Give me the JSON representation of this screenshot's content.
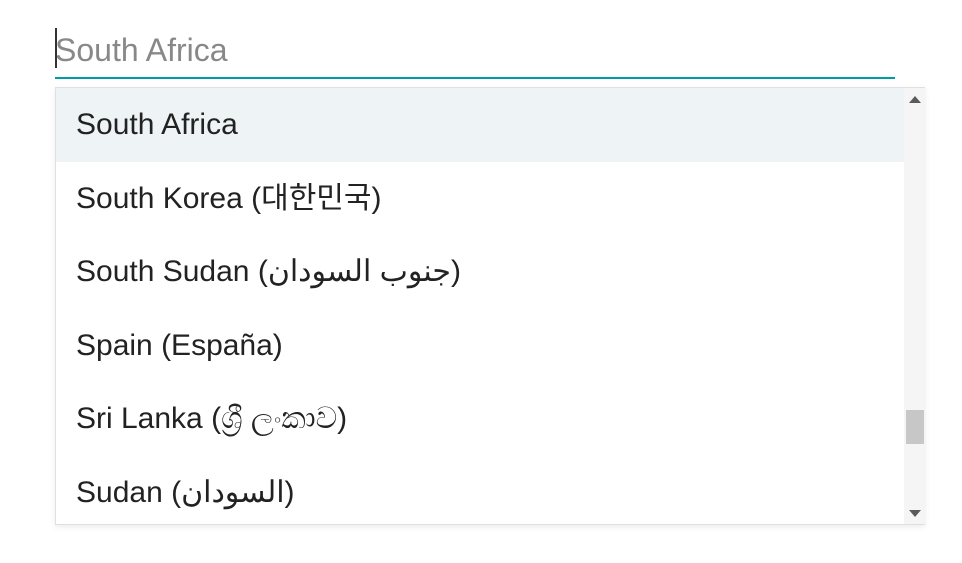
{
  "search": {
    "placeholder": "South Africa",
    "value": ""
  },
  "dropdown": {
    "highlighted_index": 0,
    "options": [
      {
        "label": "South Africa"
      },
      {
        "label": "South Korea (대한민국)"
      },
      {
        "label": "South Sudan (جنوب السودان)"
      },
      {
        "label": "Spain (España)"
      },
      {
        "label": "Sri Lanka (ශ්‍රී ලංකාව)"
      },
      {
        "label": "Sudan (السودان)"
      }
    ]
  },
  "colors": {
    "accent": "#009ca6",
    "highlight_bg": "#eef3f5"
  }
}
